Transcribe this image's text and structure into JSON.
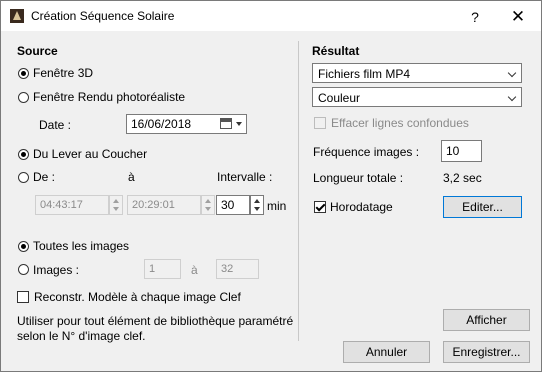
{
  "window": {
    "title": "Création Séquence Solaire",
    "help": "?",
    "close": "✕"
  },
  "source": {
    "heading": "Source",
    "fenetre3d": "Fenêtre 3D",
    "rendu": "Fenêtre Rendu photoréaliste",
    "date_label": "Date :",
    "date_value": "16/06/2018",
    "lever_coucher": "Du Lever au Coucher",
    "de": "De :",
    "a": "à",
    "intervalle": "Intervalle :",
    "start_time": "04:43:17",
    "end_time": "20:29:01",
    "interval_value": "30",
    "min": "min",
    "toutes_images": "Toutes les images",
    "images_label": "Images :",
    "images_from": "1",
    "images_a": "à",
    "images_to": "32",
    "reconstr": "Reconstr. Modèle à chaque image Clef",
    "note": "Utiliser pour tout élément de bibliothèque paramétré selon le N° d'image clef."
  },
  "result": {
    "heading": "Résultat",
    "format": "Fichiers film MP4",
    "color": "Couleur",
    "effacer": "Effacer lignes confondues",
    "frequence_label": "Fréquence images :",
    "frequence_value": "10",
    "longueur_label": "Longueur totale :",
    "longueur_value": "3,2 sec",
    "horodatage": "Horodatage",
    "editer": "Editer..."
  },
  "buttons": {
    "afficher": "Afficher",
    "annuler": "Annuler",
    "enregistrer": "Enregistrer..."
  }
}
